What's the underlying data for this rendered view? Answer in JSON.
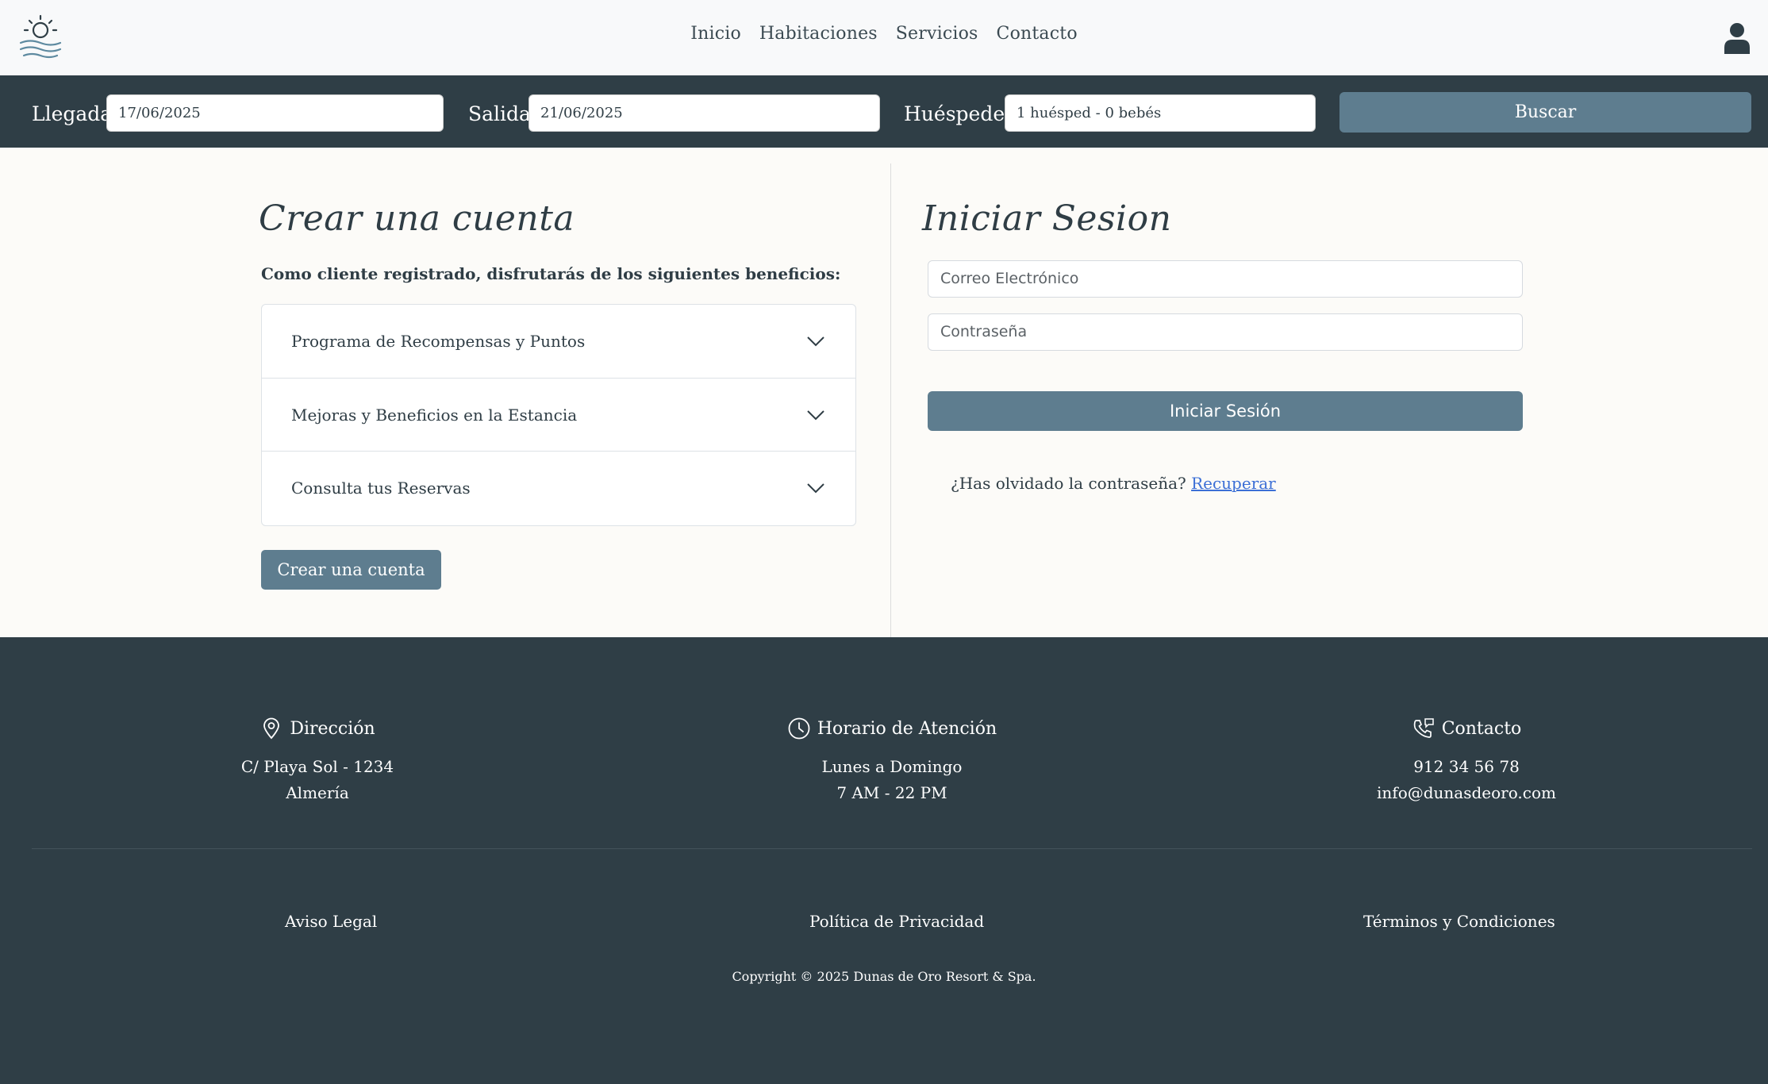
{
  "header": {
    "logo_icon": "sun-over-waves-icon",
    "nav": [
      "Inicio",
      "Habitaciones",
      "Servicios",
      "Contacto"
    ],
    "user_icon": "user-icon"
  },
  "booking": {
    "arrival_label": "Llegada",
    "arrival_value": "17/06/2025",
    "departure_label": "Salida",
    "departure_value": "21/06/2025",
    "guests_label": "Huéspedes",
    "guests_value": "1 huésped - 0 bebés",
    "search_label": "Buscar"
  },
  "create_account": {
    "title": "Crear una cuenta",
    "intro": "Como cliente registrado, disfrutarás de los siguientes beneficios:",
    "benefits": [
      "Programa de Recompensas y Puntos",
      "Mejoras y Beneficios en la Estancia",
      "Consulta tus Reservas"
    ],
    "button": "Crear una cuenta"
  },
  "login": {
    "title": "Iniciar Sesion",
    "email_placeholder": "Correo Electrónico",
    "password_placeholder": "Contraseña",
    "button": "Iniciar Sesión",
    "forgot_text": "¿Has olvidado la contraseña?",
    "recover_link": "Recuperar"
  },
  "footer": {
    "address": {
      "title": "Dirección",
      "lines": [
        "C/ Playa Sol - 1234",
        "Almería"
      ],
      "icon": "location-pin-icon"
    },
    "hours": {
      "title": "Horario de Atención",
      "lines": [
        "Lunes a Domingo",
        "7 AM - 22 PM"
      ],
      "icon": "clock-icon"
    },
    "contact": {
      "title": "Contacto",
      "lines": [
        "912 34 56 78",
        "info@dunasdeoro.com"
      ],
      "icon": "phone-chat-icon"
    },
    "links": [
      "Aviso Legal",
      "Política de Privacidad",
      "Términos y Condiciones"
    ],
    "copyright": "Copyright © 2025 Dunas de Oro Resort & Spa."
  },
  "colors": {
    "dark": "#2f3e46",
    "accent": "#5e7d8f",
    "background": "#fcfbf8",
    "link": "#3c6fd6"
  }
}
